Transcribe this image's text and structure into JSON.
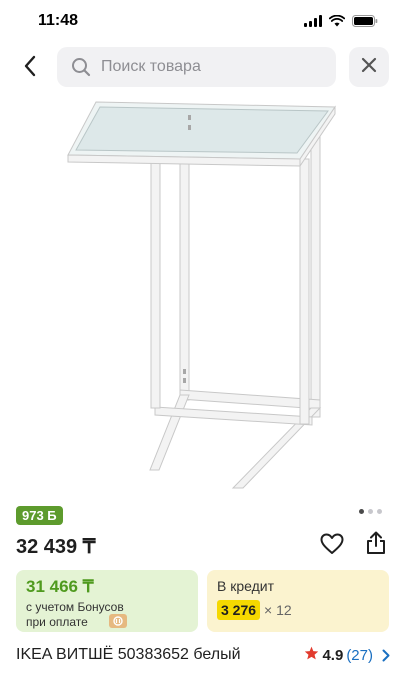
{
  "status_bar": {
    "time": "11:48",
    "icons": [
      "signal-icon",
      "wifi-icon",
      "battery-icon"
    ]
  },
  "search": {
    "placeholder": "Поиск товара",
    "icons": [
      "chevron-left-icon",
      "search-icon",
      "close-icon"
    ]
  },
  "gallery": {
    "pages": 3,
    "active_page": 1
  },
  "product": {
    "bonus_badge": "973 Б",
    "price": "32 439 ₸",
    "title": "IKEA ВИТШЁ 50383652 белый",
    "rating": "4.9",
    "reviews": "(27)"
  },
  "bonus_card": {
    "price": "31 466 ₸",
    "note_line1": "с учетом Бонусов",
    "note_line2": "при оплате"
  },
  "credit_card": {
    "title": "В кредит",
    "amount": "3 276",
    "multiplier": "× 12"
  },
  "colors": {
    "bonus_green": "#5d9b2d",
    "credit_yellow": "#f5d800",
    "link_blue": "#1a6fc1",
    "star_red": "#e23b2e"
  }
}
